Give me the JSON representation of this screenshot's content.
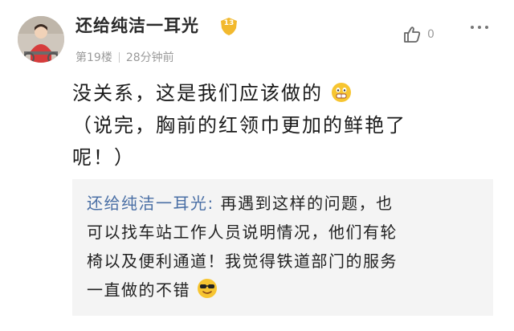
{
  "comment": {
    "username": "还给纯洁一耳光",
    "level": "13",
    "floor": "第19楼",
    "time": "28分钟前",
    "like_count": "0",
    "line1": "没关系，这是我们应该做的",
    "line2": "（说完，胸前的红领巾更加的鲜艳了",
    "line3": "呢！）"
  },
  "reply": {
    "author": "还给纯洁一耳光:",
    "line1": " 再遇到这样的问题，也",
    "line2": "可以找车站工作人员说明情况，他们有轮",
    "line3": "椅以及便利通道！我觉得铁道部门的服务",
    "line4": "一直做的不错"
  },
  "icons": {
    "level_badge": "shield-badge-icon",
    "like": "thumbs-up-icon",
    "more": "more-dots-icon",
    "emoji_grin": "grinning-face-icon",
    "emoji_sunglasses": "sunglasses-face-icon"
  },
  "colors": {
    "username_link": "#4a6fa5",
    "badge": "#f2b92e",
    "reply_bg": "#f4f4f4"
  }
}
